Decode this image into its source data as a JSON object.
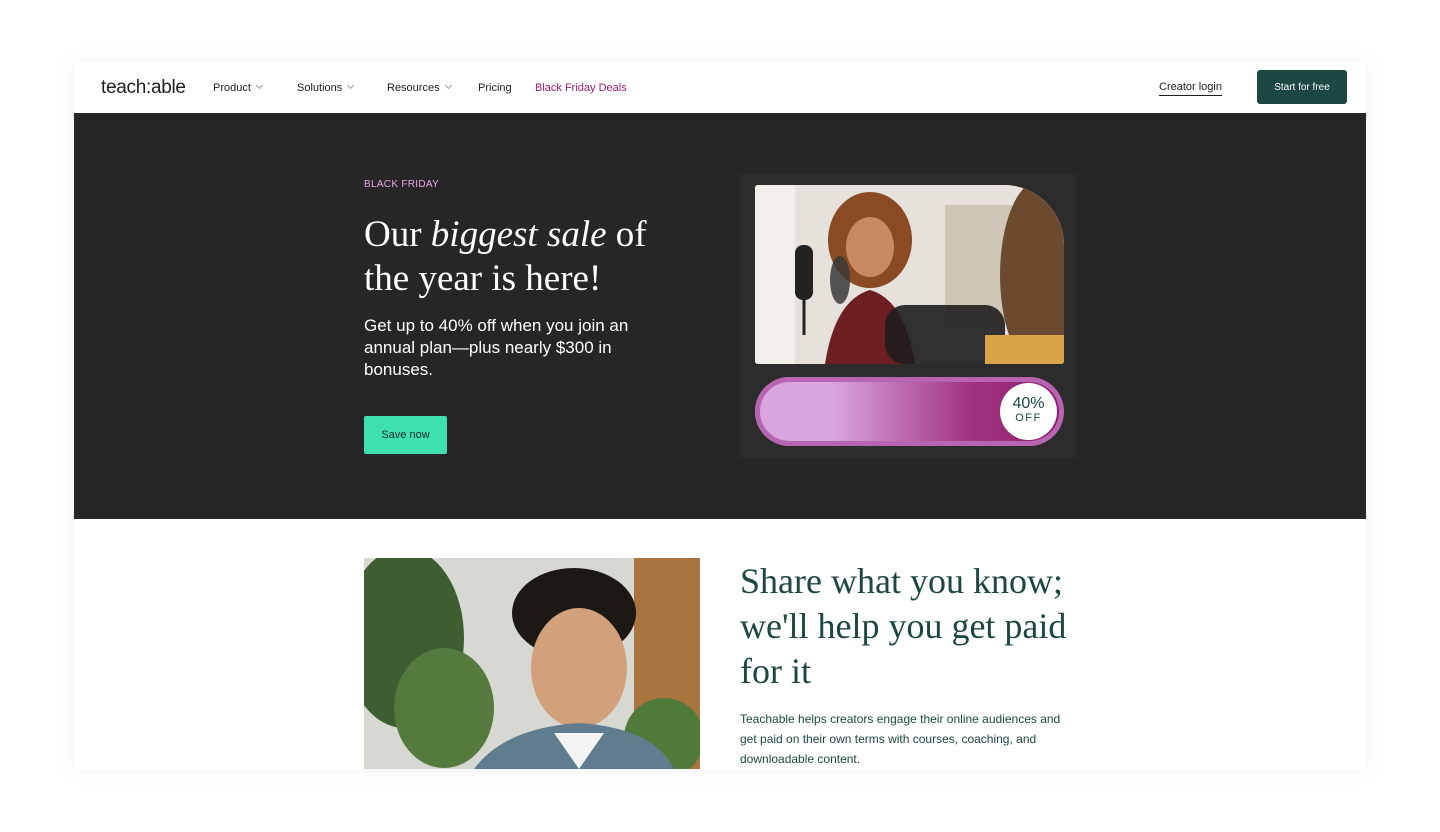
{
  "nav": {
    "logo": "teach:able",
    "items": [
      {
        "label": "Product",
        "has_dropdown": true
      },
      {
        "label": "Solutions",
        "has_dropdown": true
      },
      {
        "label": "Resources",
        "has_dropdown": true
      },
      {
        "label": "Pricing",
        "has_dropdown": false
      }
    ],
    "deals": "Black Friday Deals",
    "creator_login": "Creator login",
    "start_button": "Start for free"
  },
  "hero": {
    "eyebrow": "BLACK FRIDAY",
    "title_pre": "Our ",
    "title_em": "biggest sale",
    "title_post": " of the year is here!",
    "subtitle": "Get up to 40% off when you join an annual plan—plus nearly $300 in bonuses.",
    "cta": "Save now",
    "promo": {
      "percent": "40%",
      "off": "OFF"
    }
  },
  "lower": {
    "title": "Share what you know; we'll help you get paid for it",
    "body": "Teachable helps creators engage their online audiences and get paid on their own terms with courses, coaching, and downloadable content."
  },
  "colors": {
    "brand_dark": "#1d4741",
    "hero_bg": "#262626",
    "accent_mint": "#3fe0b0",
    "deals_magenta": "#9b1c6f",
    "eyebrow_pink": "#e9a6e6"
  }
}
